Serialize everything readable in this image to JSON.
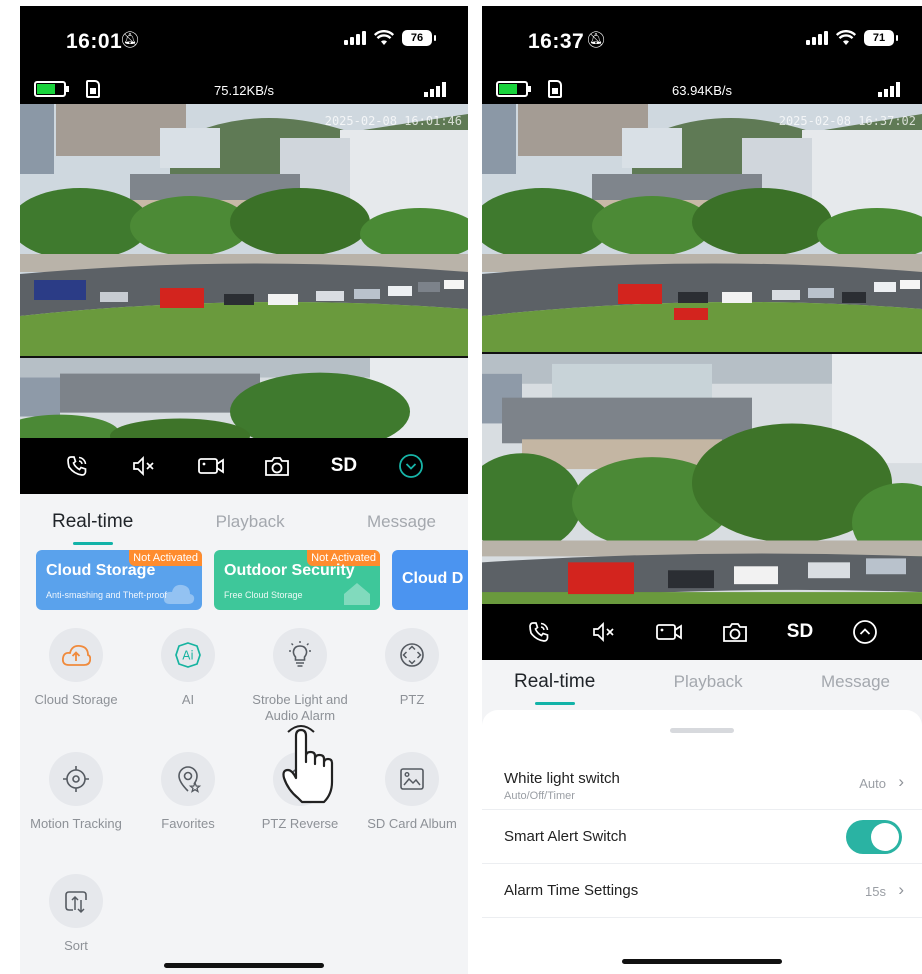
{
  "left": {
    "status": {
      "time": "16:01",
      "battery": "76"
    },
    "camera": {
      "speed": "75.12KB/s",
      "timestamp": "2025-02-08 16:01:46"
    },
    "controls": {
      "quality": "SD"
    },
    "tabs": [
      {
        "label": "Real-time"
      },
      {
        "label": "Playback"
      },
      {
        "label": "Message"
      }
    ],
    "banners": [
      {
        "title": "Cloud Storage",
        "subtitle": "Anti-smashing and Theft-proof",
        "badge": "Not Activated",
        "color": "#5aa2ec"
      },
      {
        "title": "Outdoor Security",
        "subtitle": "Free Cloud Storage",
        "badge": "Not Activated",
        "color": "#3ec79a"
      },
      {
        "title": "Cloud D",
        "color": "#4b94f0"
      }
    ],
    "features": [
      {
        "label": "Cloud Storage",
        "icon": "cloud-upload-icon",
        "color": "#f08a3c"
      },
      {
        "label": "AI",
        "icon": "ai-icon",
        "color": "#16b3a0"
      },
      {
        "label": "Strobe Light and Audio Alarm",
        "icon": "light-bulb-icon",
        "color": "#555a61"
      },
      {
        "label": "PTZ",
        "icon": "ptz-icon",
        "color": "#555a61"
      },
      {
        "label": "Motion Tracking",
        "icon": "target-icon",
        "color": "#555a61"
      },
      {
        "label": "Favorites",
        "icon": "favorites-icon",
        "color": "#555a61"
      },
      {
        "label": "PTZ Reverse",
        "icon": "ptz-reverse-icon",
        "color": "#555a61"
      },
      {
        "label": "SD Card Album",
        "icon": "album-icon",
        "color": "#555a61"
      },
      {
        "label": "Sort",
        "icon": "sort-icon",
        "color": "#555a61"
      }
    ]
  },
  "right": {
    "status": {
      "time": "16:37",
      "battery": "71"
    },
    "camera": {
      "speed": "63.94KB/s",
      "timestamp": "2025-02-08 16:37:02"
    },
    "controls": {
      "quality": "SD"
    },
    "tabs": [
      {
        "label": "Real-time"
      },
      {
        "label": "Playback"
      },
      {
        "label": "Message"
      }
    ],
    "settings": [
      {
        "title": "White light switch",
        "subtitle": "Auto/Off/Timer",
        "value": "Auto"
      },
      {
        "title": "Smart Alert Switch",
        "toggle_on": true
      },
      {
        "title": "Alarm Time Settings",
        "value": "15s"
      }
    ]
  },
  "colors": {
    "accent": "#12b3a8",
    "toggle": "#2ab3a3",
    "badge": "#ff8c2e"
  }
}
